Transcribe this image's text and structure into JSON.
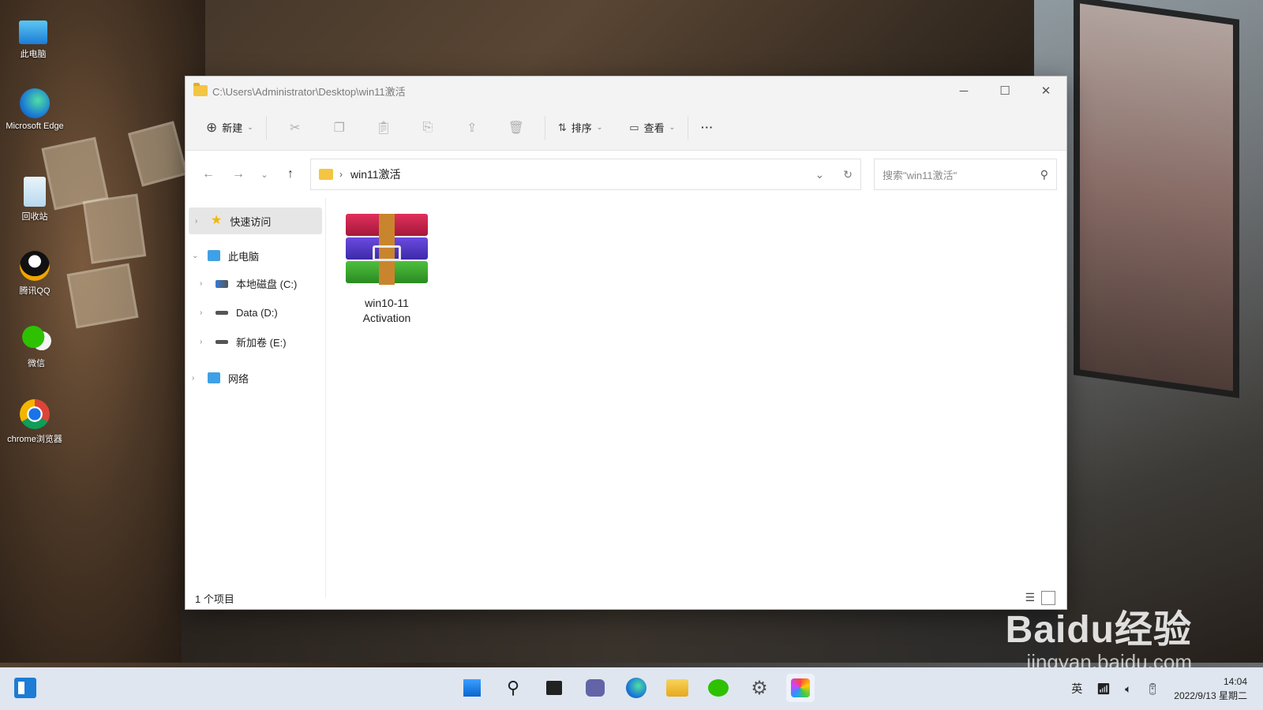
{
  "desktop": {
    "icons": [
      {
        "label": "此电脑"
      },
      {
        "label": "Microsoft Edge"
      },
      {
        "label": "回收站"
      },
      {
        "label": "腾讯QQ"
      },
      {
        "label": "微信"
      },
      {
        "label": "chrome浏览器"
      }
    ]
  },
  "window": {
    "title": "C:\\Users\\Administrator\\Desktop\\win11激活",
    "toolbar": {
      "new_label": "新建",
      "sort_label": "排序",
      "view_label": "查看",
      "more_label": "···"
    },
    "address": {
      "current_folder": "win11激活",
      "separator": "›"
    },
    "search": {
      "placeholder": "搜索\"win11激活\""
    },
    "nav": {
      "quick_access": "快速访问",
      "this_pc": "此电脑",
      "drive_c": "本地磁盘 (C:)",
      "drive_d": "Data (D:)",
      "drive_e": "新加卷 (E:)",
      "network": "网络"
    },
    "files": [
      {
        "name": "win10-11 Activation"
      }
    ],
    "status": {
      "item_count": "1 个项目"
    }
  },
  "watermark": {
    "main": "Baidu经验",
    "sub": "jingyan.baidu.com"
  },
  "taskbar": {
    "ime": "英",
    "time": "14:04",
    "date": "2022/9/13 星期二"
  },
  "colors": {
    "accent": "#1c7cd6",
    "folder": "#f4c542"
  }
}
